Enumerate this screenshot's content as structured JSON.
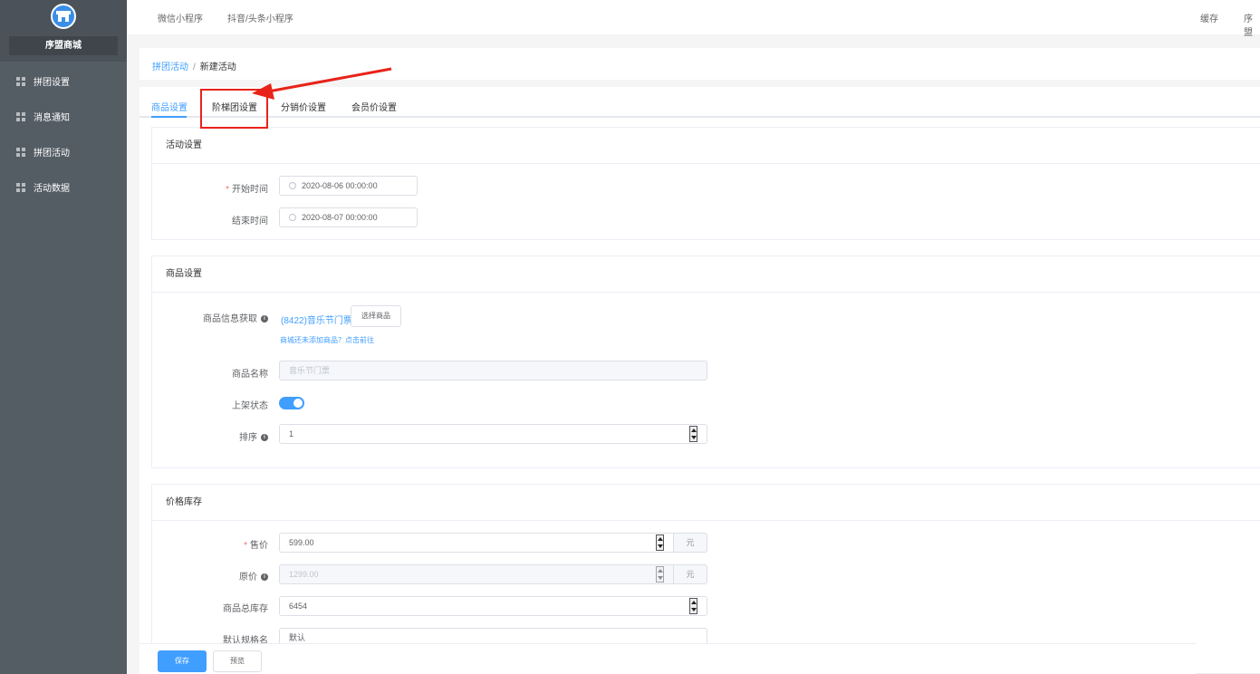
{
  "sidebar": {
    "shop_name": "序盟商城",
    "items": [
      {
        "label": "拼团设置"
      },
      {
        "label": "消息通知"
      },
      {
        "label": "拼团活动"
      },
      {
        "label": "活动数据"
      }
    ]
  },
  "topbar": {
    "tabs": [
      "微信小程序",
      "抖音/头条小程序"
    ],
    "right_cache": "缓存",
    "right_user": "序盟"
  },
  "breadcrumb": {
    "parent": "拼团活动",
    "separator": "/",
    "current": "新建活动"
  },
  "tabs": [
    {
      "label": "商品设置",
      "active": true
    },
    {
      "label": "阶梯团设置",
      "active": false
    },
    {
      "label": "分销价设置",
      "active": false
    },
    {
      "label": "会员价设置",
      "active": false
    }
  ],
  "activity": {
    "title": "活动设置",
    "start_label": "开始时间",
    "start_value": "2020-08-06 00:00:00",
    "end_label": "结束时间",
    "end_value": "2020-08-07 00:00:00"
  },
  "product": {
    "title": "商品设置",
    "source_label": "商品信息获取",
    "source_value": "(8422)音乐节门票",
    "select_button": "选择商品",
    "hint": "商城还未添加商品？点击前往",
    "name_label": "商品名称",
    "name_placeholder": "音乐节门票",
    "status_label": "上架状态",
    "status_on": true,
    "sort_label": "排序",
    "sort_value": "1"
  },
  "price": {
    "title": "价格库存",
    "sale_label": "售价",
    "sale_value": "599.00",
    "unit": "元",
    "orig_label": "原价",
    "orig_value": "1299.00",
    "stock_label": "商品总库存",
    "stock_value": "6454",
    "spec_label": "默认规格名",
    "spec_value": "默认"
  },
  "footer": {
    "save": "保存",
    "preview": "预览"
  },
  "colors": {
    "accent": "#409eff",
    "sidebar": "#545c64",
    "annotation": "#e8231a"
  }
}
